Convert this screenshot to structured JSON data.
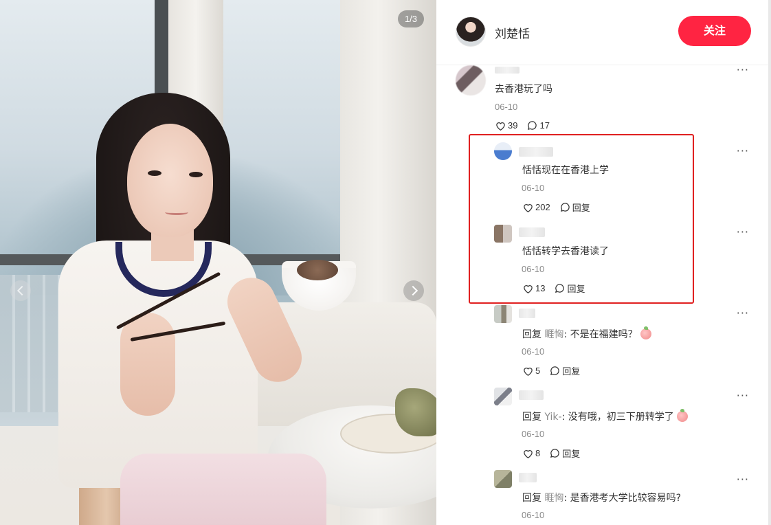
{
  "photo": {
    "page_counter": "1/3"
  },
  "author": {
    "name": "刘楚恬",
    "follow_label": "关注"
  },
  "comments": [
    {
      "text": "去香港玩了吗",
      "date": "06-10",
      "likes": "39",
      "replies": "17"
    },
    {
      "text": "恬恬现在在香港上学",
      "date": "06-10",
      "likes": "202",
      "reply_label": "回复"
    },
    {
      "text": "恬恬转学去香港读了",
      "date": "06-10",
      "likes": "13",
      "reply_label": "回复"
    },
    {
      "reply_prefix": "回复",
      "mention": "睚恟",
      "text": ": 不是在福建吗？",
      "date": "06-10",
      "likes": "5",
      "reply_label": "回复"
    },
    {
      "reply_prefix": "回复",
      "mention": "Yik-",
      "text": ": 没有哦，初三下册转学了",
      "date": "06-10",
      "likes": "8",
      "reply_label": "回复"
    },
    {
      "reply_prefix": "回复",
      "mention": "睚恟",
      "text": ": 是香港考大学比较容易吗?",
      "date": "06-10"
    }
  ],
  "colors": {
    "accent": "#ff2442",
    "highlight_box": "#e02020",
    "mention": "#8a8a8a"
  },
  "icons": {
    "like": "heart-icon",
    "reply": "chat-bubble-icon",
    "more": "more-dots-icon",
    "emoji": "peach-emoji-icon"
  }
}
